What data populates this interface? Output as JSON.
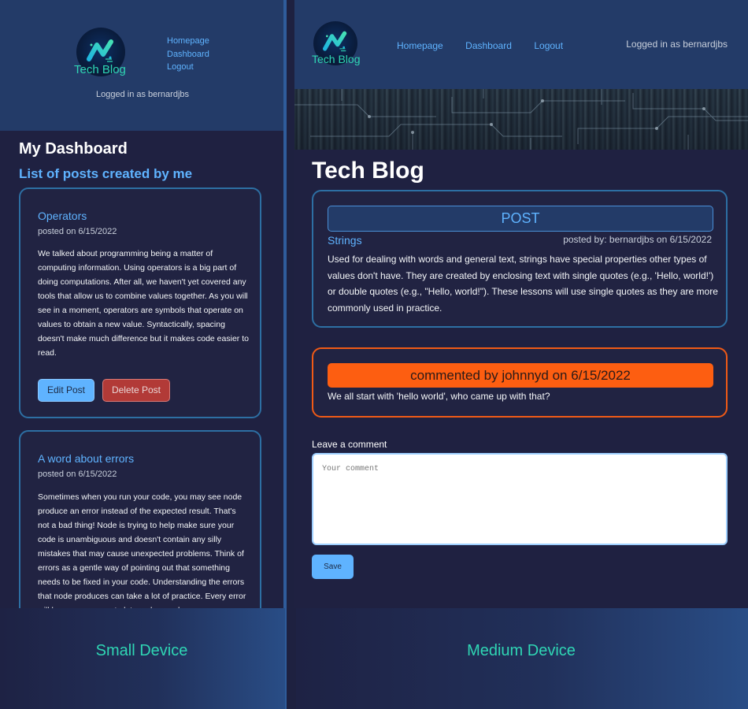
{
  "small_device": {
    "logo_text": "Tech Blog",
    "nav": [
      "Homepage",
      "Dashboard",
      "Logout"
    ],
    "logged_in": "Logged in as bernardjbs",
    "page_title": "My Dashboard",
    "subtitle": "List of posts created by me",
    "posts": [
      {
        "title": "Operators",
        "date": "posted on 6/15/2022",
        "body": "We talked about programming being a matter of computing information. Using operators is a big part of doing computations. After all, we haven't yet covered any tools that allow us to combine values together. As you will see in a moment, operators are symbols that operate on values to obtain a new value. Syntactically, spacing doesn't make much difference but it makes code easier to read.",
        "edit_label": "Edit Post",
        "delete_label": "Delete Post"
      },
      {
        "title": "A word about errors",
        "date": "posted on 6/15/2022",
        "body": "Sometimes when you run your code, you may see node produce an error instead of the expected result. That's not a bad thing! Node is trying to help make sure your code is unambiguous and doesn't contain any silly mistakes that may cause unexpected problems. Think of errors as a gentle way of pointing out that something needs to be fixed in your code. Understanding the errors that node produces can take a lot of practice. Every error will have a message to let you know why"
      }
    ],
    "caption": "Small Device"
  },
  "medium_device": {
    "logo_text": "Tech Blog",
    "nav": [
      "Homepage",
      "Dashboard",
      "Logout"
    ],
    "logged_in": "Logged in as bernardjbs",
    "page_title": "Tech Blog",
    "post": {
      "header": "POST",
      "title": "Strings",
      "meta": "posted by: bernardjbs on 6/15/2022",
      "body": "Used for dealing with words and general text, strings have special properties other types of values don't have. They are created by enclosing text with single quotes (e.g., 'Hello, world!') or double quotes (e.g., \"Hello, world!\"). These lessons will use single quotes as they are more commonly used in practice."
    },
    "comment": {
      "header": "commented by johnnyd on 6/15/2022",
      "text": "We all start with 'hello world', who came up with that?"
    },
    "form": {
      "label": "Leave a comment",
      "placeholder": "Your comment",
      "save_label": "Save"
    },
    "caption": "Medium Device"
  },
  "colors": {
    "header_bg": "#233b68",
    "page_bg": "#1f2141",
    "accent_blue": "#5fb3ff",
    "card_border": "#2d6fa3",
    "comment_orange": "#fd5e11",
    "delete_red": "#b23a37",
    "logo_teal": "#2fd6b4"
  }
}
